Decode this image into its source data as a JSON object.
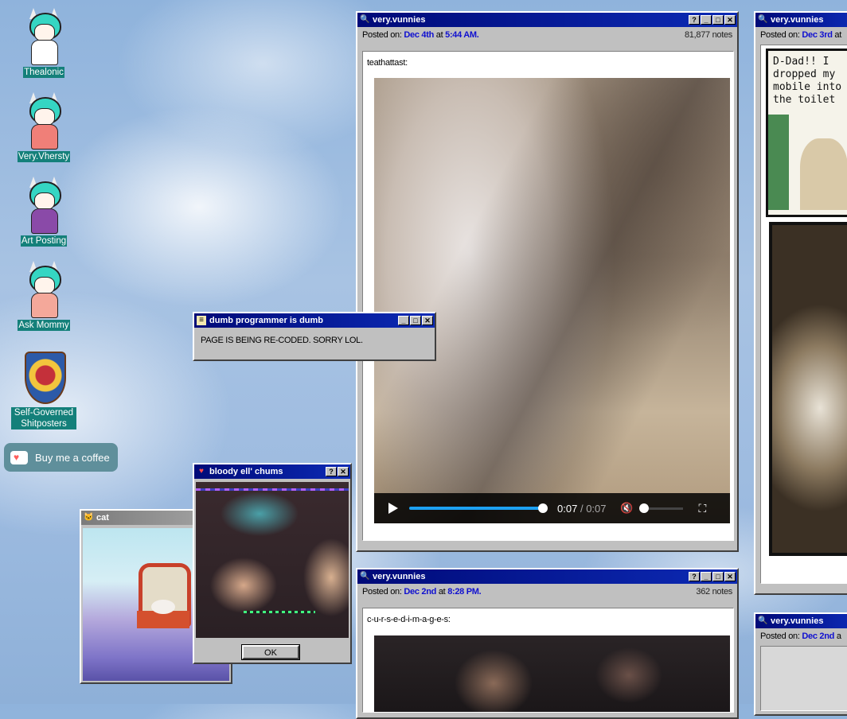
{
  "desktop_icons": [
    {
      "label": "Thealonic"
    },
    {
      "label": "Very.Vhersty"
    },
    {
      "label": "Art Posting"
    },
    {
      "label": "Ask Mommy"
    },
    {
      "label": "Self-Governed Shitposters"
    }
  ],
  "coffee_button": {
    "label": "Buy me a coffee"
  },
  "post1": {
    "title": "very.vunnies",
    "posted_on_label": "Posted on:",
    "date": "Dec 4th",
    "at_label": "at",
    "time": "5:44 AM.",
    "notes": "81,877 notes",
    "caption": "teathattast:",
    "video": {
      "current": "0:07",
      "separator": "/",
      "duration": "0:07",
      "progress": 1.0
    }
  },
  "post2": {
    "title": "very.vunnies",
    "posted_on_label": "Posted on:",
    "date": "Dec 2nd",
    "at_label": "at",
    "time": "8:28 PM.",
    "notes": "362 notes",
    "caption": "c-u-r-s-e-d-i-m-a-g-e-s:"
  },
  "post3": {
    "title": "very.vunnies",
    "posted_on_label": "Posted on:",
    "date": "Dec 3rd",
    "at_label": "at",
    "comic_text": "D-Dad!! I dropped my mobile into the toilet"
  },
  "post4": {
    "title": "very.vunnies",
    "posted_on_label": "Posted on:",
    "date": "Dec 2nd",
    "at_label": "a"
  },
  "dialog_programmer": {
    "title": "dumb programmer is dumb",
    "message": "PAGE IS BEING RE-CODED. SORRY LOL."
  },
  "dialog_chums": {
    "title": "bloody ell' chums",
    "ok_label": "OK"
  },
  "window_cat": {
    "title": "cat"
  },
  "colors": {
    "titlebar": "#000a78",
    "link_blue": "#1010d0",
    "icon_label_bg": "#14807a"
  }
}
